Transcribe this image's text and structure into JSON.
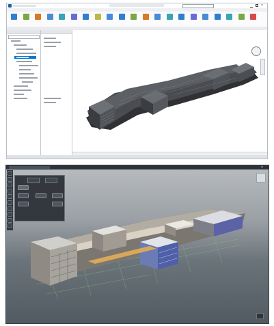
{
  "revit": {
    "title": "",
    "ribbon_colors": [
      "#2f7fd1",
      "#7aa847",
      "#d67a2a",
      "#4a8bd6",
      "#3aa3b5",
      "#6b6bd4",
      "#2f7fd1",
      "#b9b94a",
      "#4a8bd6",
      "#2f7fd1",
      "#7aa847",
      "#d67a2a",
      "#4a8bd6",
      "#3aa3b5",
      "#2f7fd1",
      "#6b6bd4",
      "#4a8bd6",
      "#2f7fd1",
      "#3aa3b5",
      "#7aa847",
      "#d64a4a"
    ],
    "left_tree": [
      "",
      "",
      "",
      "",
      "",
      "",
      "",
      "",
      "",
      "",
      "",
      "",
      "",
      "",
      ""
    ],
    "mid_tree": [
      "",
      "",
      "",
      "",
      ""
    ],
    "highlight_color": "#0078d7",
    "nav_icon": "view-cube-icon",
    "model_color": "#3d3f43"
  },
  "viewer": {
    "title": "",
    "toolbar_icons": [
      "home-icon",
      "eye-icon",
      "pin-icon",
      "layers-icon",
      "tree-icon",
      "measure-icon",
      "info-icon",
      "pencil-icon",
      "settings-icon",
      "close-icon"
    ],
    "panel": {
      "tab1": "",
      "tab2": "",
      "buttons": [
        "",
        "",
        "",
        "",
        "",
        ""
      ]
    },
    "ground_color": "#5a626a",
    "nav_icon": "view-cube-icon"
  }
}
